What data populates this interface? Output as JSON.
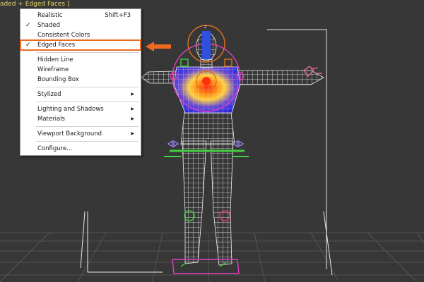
{
  "viewport": {
    "label": "aded + Edged Faces ]"
  },
  "menu": {
    "groups": [
      [
        {
          "label": "Realistic",
          "shortcut": "Shift+F3",
          "checked": false
        },
        {
          "label": "Shaded",
          "checked": true
        },
        {
          "label": "Consistent Colors",
          "checked": false
        },
        {
          "label": "Edged Faces",
          "checked": true,
          "highlighted": true
        }
      ],
      [
        {
          "label": "Hidden Line"
        },
        {
          "label": "Wireframe"
        },
        {
          "label": "Bounding Box"
        }
      ],
      [
        {
          "label": "Stylized",
          "submenu": true
        }
      ],
      [
        {
          "label": "Lighting and Shadows",
          "submenu": true
        },
        {
          "label": "Materials",
          "submenu": true
        }
      ],
      [
        {
          "label": "Viewport Background",
          "submenu": true
        }
      ],
      [
        {
          "label": "Configure..."
        }
      ]
    ],
    "check_glyph": "✓",
    "submenu_glyph": "▶"
  },
  "colors": {
    "viewport_bg": "#373737",
    "viewport_label": "#e8d46a",
    "highlight_outline": "#ee6a1e",
    "callout_arrow": "#ee6a1e",
    "mesh_wire": "#e8e8e8",
    "rig_orange": "#e07020",
    "rig_magenta": "#e040c0",
    "rig_green": "#40d040",
    "rig_blue": "#3050e0"
  },
  "icons": {
    "check": "check-icon",
    "submenu": "submenu-arrow-icon",
    "callout": "callout-arrow-icon"
  }
}
